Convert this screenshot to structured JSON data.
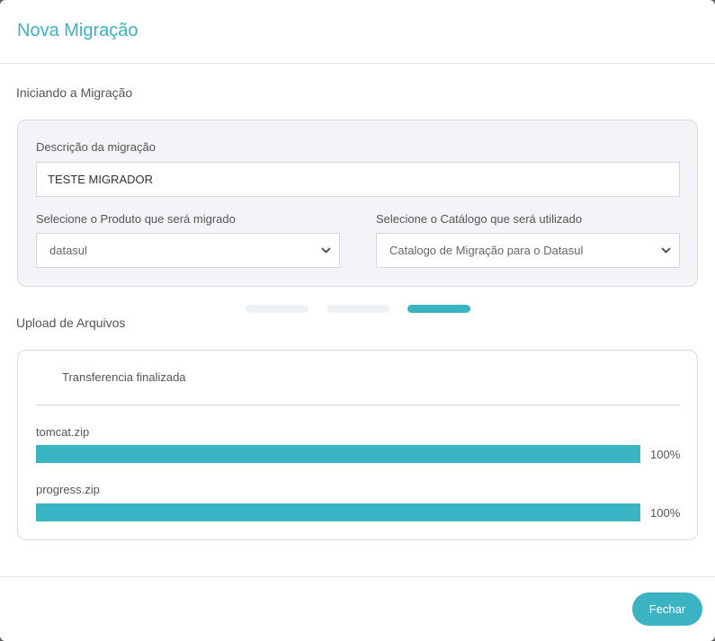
{
  "modal": {
    "title": "Nova Migração"
  },
  "migration": {
    "section_title": "Iniciando a Migração",
    "description_label": "Descrição da migração",
    "description_value": "TESTE MIGRADOR",
    "product_label": "Selecione o Produto que será migrado",
    "product_value": "datasul",
    "catalog_label": "Selecione o Catálogo que será utilizado",
    "catalog_value": "Catalogo de Migração para o Datasul"
  },
  "stepper": {
    "total_steps": 3,
    "active_step": 3
  },
  "upload": {
    "section_title": "Upload de Arquivos",
    "status": "Transferencia finalizada",
    "files": [
      {
        "name": "tomcat.zip",
        "progress_label": "100%",
        "progress": 100
      },
      {
        "name": "progress.zip",
        "progress_label": "100%",
        "progress": 100
      }
    ]
  },
  "footer": {
    "close_label": "Fechar"
  },
  "colors": {
    "accent": "#3bb3c3",
    "panel_bg": "#f3f4f7"
  },
  "icons": {
    "select_arrow": "chevron-down-icon"
  }
}
